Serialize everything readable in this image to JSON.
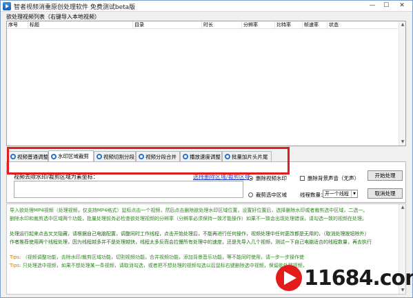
{
  "window": {
    "title": "智者视频消重原创处理软件 免费测试beta版",
    "buttons": {
      "minimize": "—",
      "maximize": "☐",
      "close": "✕"
    }
  },
  "list": {
    "caption": "欲处理视频列表（右键导入本地视频）",
    "columns": [
      "序号",
      "标题",
      "目录",
      "时长",
      "分辨率",
      "比特率",
      "帧速率",
      "状态"
    ]
  },
  "tabs": [
    {
      "label": "视频普通调整",
      "icon": "gear-icon"
    },
    {
      "label": "水印区域裁剪",
      "icon": "gear-icon"
    },
    {
      "label": "视频切割分段",
      "icon": "gear-icon"
    },
    {
      "label": "视频分段合并",
      "icon": "gear-icon"
    },
    {
      "label": "播放速度调整",
      "icon": "gear-icon"
    },
    {
      "label": "批量加片头片尾",
      "icon": "gear-icon"
    }
  ],
  "pane": {
    "field_label": "视频去除水印/裁剪区域为素坐标：",
    "field_link": "选择删除区域/裁剪区域",
    "opt_remove_watermark": "删除视频水印",
    "opt_remove_bg_audio": "删除背景声音（无声）",
    "opt_crop_area": "裁剪选中区域",
    "threads_label": "线程数量：",
    "threads_value": "开一个线程",
    "start_button": "开始处理",
    "cancel_button": "取消处理"
  },
  "info": {
    "line1": "导入欲处理MP4视频（处理视频，仅支持MP4格式）鼠标点击一个视频，然后点击删除欲处理水印区域位置，设置好位置后，选择删除水印或者裁剪选中区域，二选一。",
    "line2": "删除水印和裁剪选中区域两个功能，批量处理前务必检查欲处理视频的分辨率（分辨率必须保持一致才能操作）如果不一致会出现处理错误，请勾选一致的视频在处理。",
    "line3": "处理运行起来点击叉叉隐藏，请根据自己电脑配置，调整同时工作线程，点击开始处理后，不能再进行任何操作，视频处理中任何更改都是无用的，（取消处理按钮除外）",
    "line4": "作者推荐使用两个线程处理，因为线程越多并不是处理越快，线程太多反而会拉慢所有处理中的速度，还是先导入几个视频，测试一下自己电脑适合的线程数量，再去执行",
    "tips1_label": "Tips:",
    "tips1": "（视频调整功能，去除水印/裁剪区域功能，切割视频功能，合并视频功能，添加背景音乐功能，等不能同时使用，请一步一步操作使",
    "tips2_label": "Tips:",
    "tips2": "只处理选中视频，如果不想处理某一条视频，请取消勾选，或者把不想处理的视频勾选以后鼠标右键删除选中视频，保留欲处理视频，"
  },
  "watermark_text": "11684.com"
}
